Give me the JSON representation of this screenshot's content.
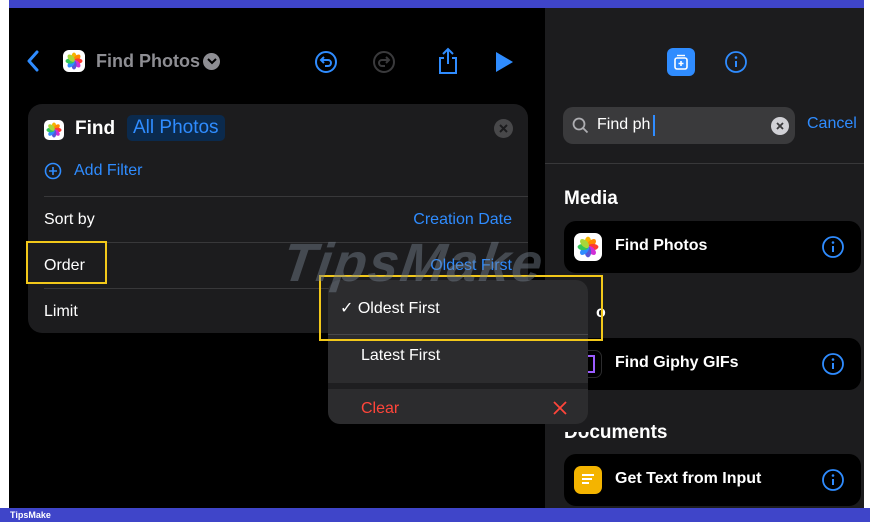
{
  "toolbar": {
    "title": "Find Photos",
    "back_icon": "chevron-left-icon",
    "undo_icon": "undo-icon",
    "redo_icon": "redo-icon",
    "share_icon": "share-icon",
    "play_icon": "play-icon"
  },
  "action": {
    "verb": "Find",
    "parameter": "All Photos",
    "add_filter": "Add Filter",
    "rows": [
      {
        "label": "Sort by",
        "value": "Creation Date"
      },
      {
        "label": "Order",
        "value": "Oldest First"
      },
      {
        "label": "Limit",
        "value": ""
      }
    ]
  },
  "menu": {
    "items": [
      {
        "label": "✓ Oldest First",
        "selected": true
      },
      {
        "label": "Latest First",
        "selected": false
      },
      {
        "label": "Clear",
        "destructive": true
      }
    ]
  },
  "watermark": "TipsMake",
  "footer": "TipsMake",
  "search": {
    "value": "Find ph",
    "cancel": "Cancel"
  },
  "sections": {
    "media": "Media",
    "docs": "Documents"
  },
  "results": [
    {
      "label": "Find Photos",
      "icon": "photos-icon"
    },
    {
      "label": "Find Giphy GIFs",
      "icon": "giphy-icon"
    },
    {
      "label": "Get Text from Input",
      "icon": "notes-icon"
    }
  ],
  "partial_text": "o",
  "colors": {
    "accent": "#2f8cff",
    "highlight": "#f2c81a",
    "destructive": "#ff453a",
    "frame": "#3f45c9"
  }
}
